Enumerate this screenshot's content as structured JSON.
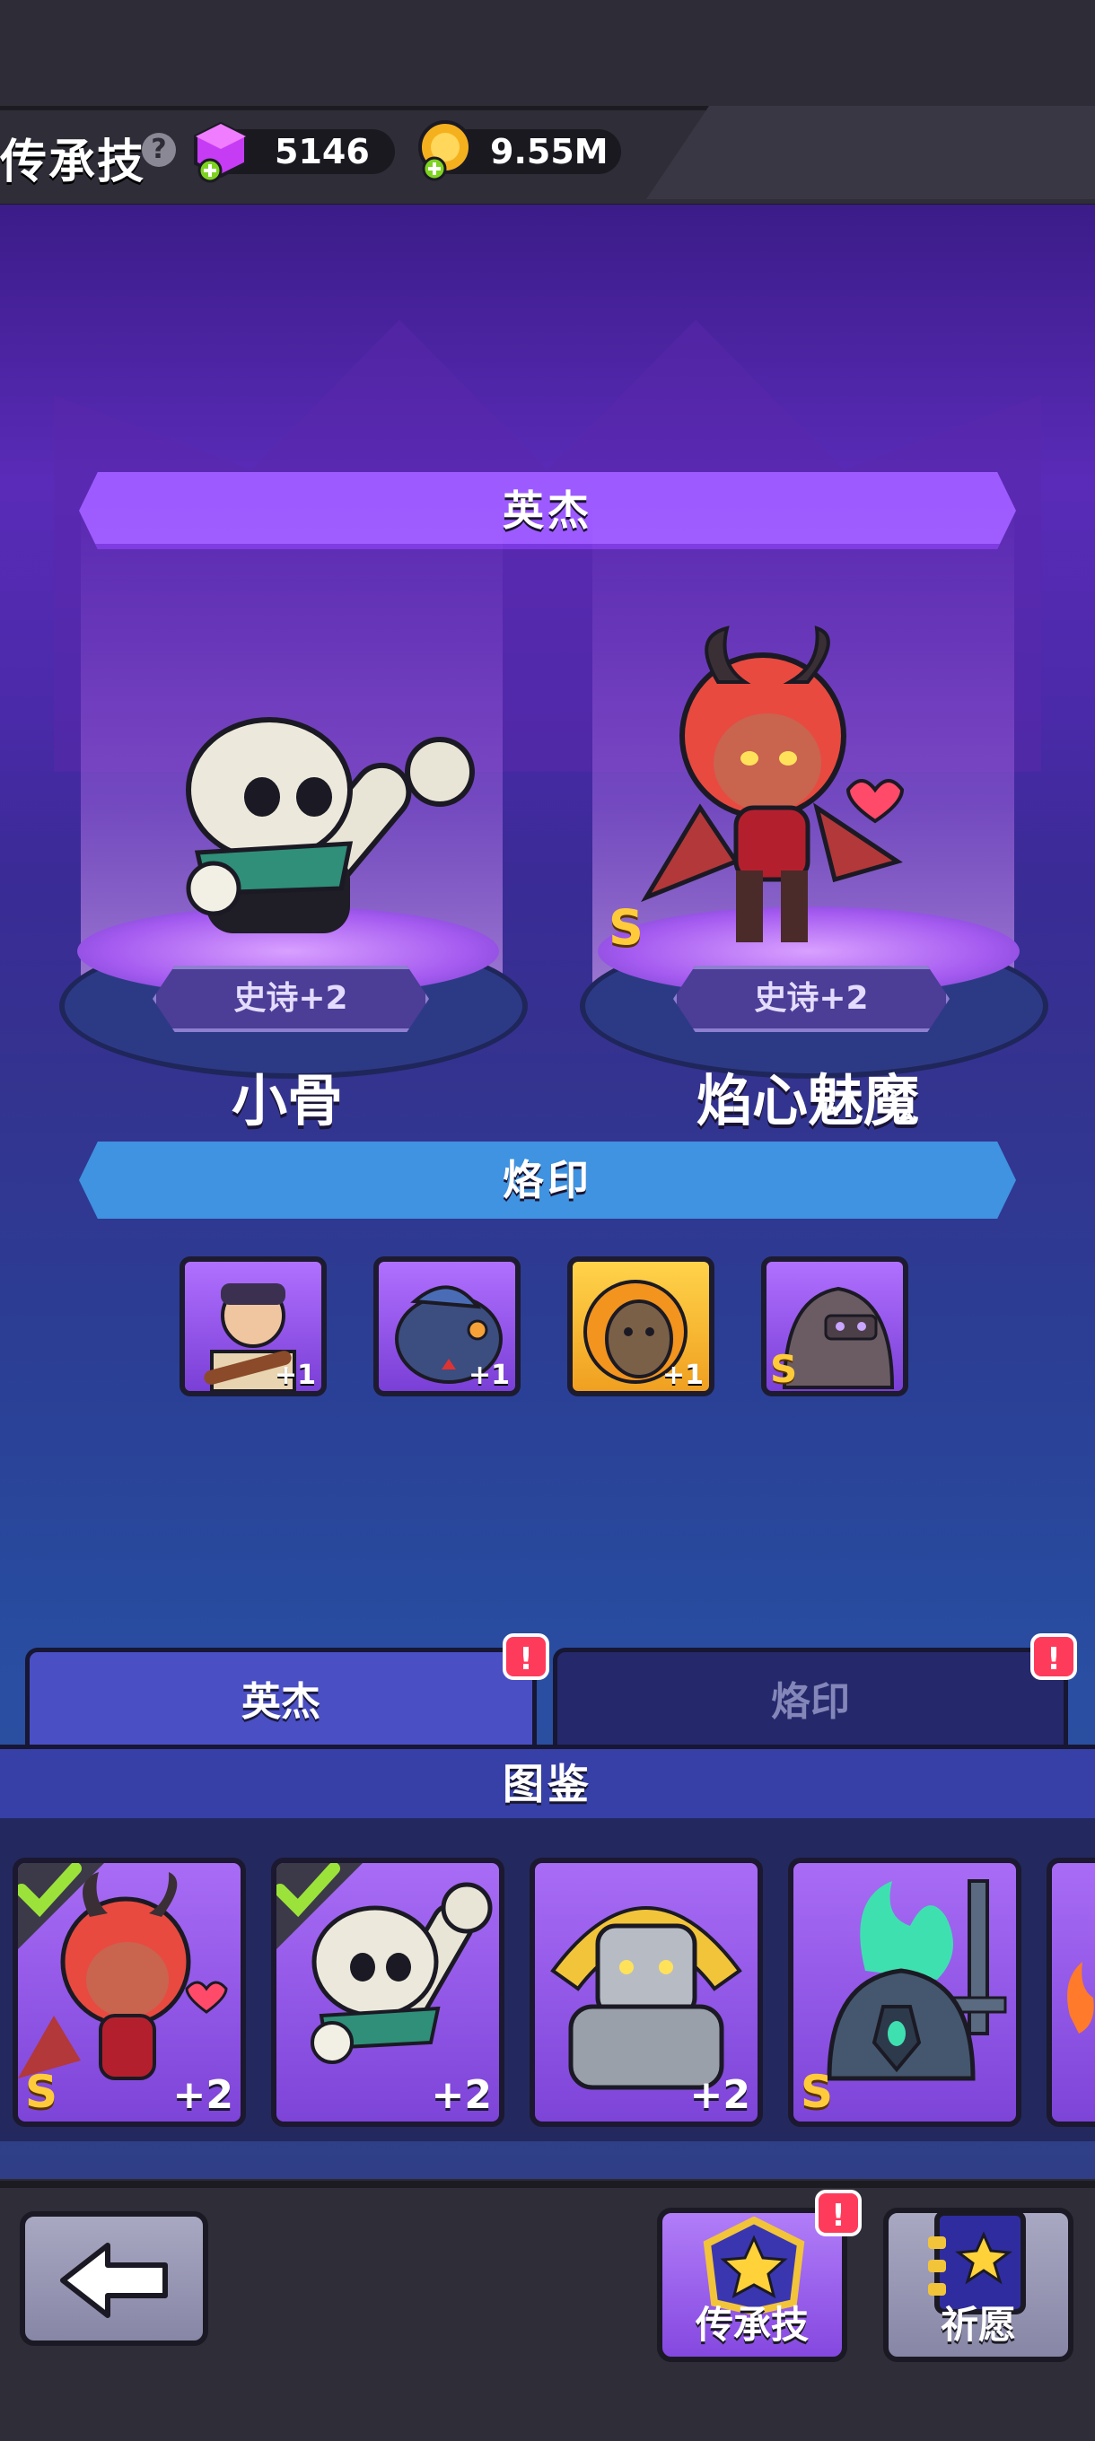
{
  "header": {
    "title": "传承技",
    "help_icon": "?",
    "gems": "5146",
    "gold": "9.55M"
  },
  "heroes_banner": "英杰",
  "heroes": [
    {
      "name": "小骨",
      "rank": "史诗+2",
      "grade": ""
    },
    {
      "name": "焰心魅魔",
      "rank": "史诗+2",
      "grade": "S"
    }
  ],
  "imprint_banner": "烙印",
  "imprint_slots": [
    {
      "icon": "warrior-portrait",
      "badge": "+1",
      "grade": ""
    },
    {
      "icon": "fish-portrait",
      "badge": "+1",
      "grade": ""
    },
    {
      "icon": "lion-portrait",
      "badge": "+1",
      "grade": ""
    },
    {
      "icon": "golem-portrait",
      "badge": "",
      "grade": "S"
    }
  ],
  "tabs": {
    "heroes": "英杰",
    "imprint": "烙印",
    "alert": "!"
  },
  "codex_title": "图鉴",
  "codex_cards": [
    {
      "icon": "succubus-portrait",
      "badge": "+2",
      "grade": "S",
      "checked": true
    },
    {
      "icon": "skeleton-portrait",
      "badge": "+2",
      "grade": "",
      "checked": true
    },
    {
      "icon": "stone-golem-portrait",
      "badge": "+2",
      "grade": "",
      "checked": false
    },
    {
      "icon": "spirit-knight-portrait",
      "badge": "",
      "grade": "S",
      "checked": false
    }
  ],
  "bottom": {
    "legacy_label": "传承技",
    "wish_label": "祈愿",
    "alert": "!"
  },
  "colors": {
    "accent_purple": "#9d5bff",
    "accent_blue": "#3f93e0",
    "alert_red": "#ff3b5c",
    "grade_gold": "#ffcb3a"
  }
}
